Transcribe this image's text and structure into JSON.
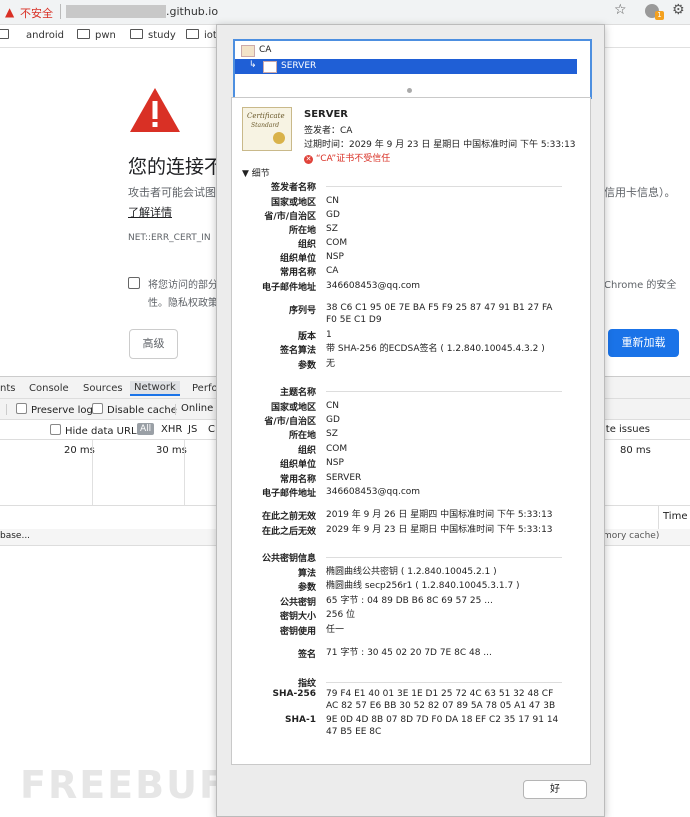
{
  "browser": {
    "insecure_label": "不安全",
    "url_suffix": ".github.io",
    "bookmarks": [
      "android",
      "pwn",
      "study",
      "iot"
    ],
    "extension_badge": "1"
  },
  "error_page": {
    "title": "您的连接不",
    "body": "攻击者可能会试图",
    "body_right": "信用卡信息）。",
    "learn_more": "了解详情",
    "error_code": "NET::ERR_CERT_IN",
    "checkbox_text_1": "将您访问的部分",
    "checkbox_text_1_right": "Chrome 的安全",
    "checkbox_text_2": "性。隐私权政策",
    "advanced_button": "高级",
    "reload_button": "重新加载"
  },
  "devtools": {
    "tabs": [
      "nts",
      "Console",
      "Sources",
      "Network",
      "Perfo"
    ],
    "active_tab": "Network",
    "preserve_log": "Preserve log",
    "disable_cache": "Disable cache",
    "online": "Online",
    "hide_data_urls": "Hide data URLs",
    "filter_all": "All",
    "filter_xhr": "XHR",
    "filter_js": "JS",
    "filter_c": "C",
    "site_issues": "ite issues",
    "timeline": [
      "20 ms",
      "30 ms",
      "80 ms"
    ],
    "time_header": "Time",
    "row_left": "base...",
    "row_right": "mory cache)"
  },
  "dialog": {
    "chain": [
      "CA",
      "SERVER"
    ],
    "ok_button": "好",
    "cert": {
      "name": "SERVER",
      "issuer_line": "签发者：CA",
      "expiry_line": "过期时间：2029 年 9 月 23 日 星期日 中国标准时间 下午 5:33:13",
      "untrusted": "“CA”证书不受信任",
      "details_label": "细节",
      "thumb_title": "Certificate",
      "thumb_subtitle": "Standard"
    },
    "issuer_section": {
      "title": "签发者名称",
      "rows": [
        {
          "label": "国家或地区",
          "value": "CN"
        },
        {
          "label": "省/市/自治区",
          "value": "GD"
        },
        {
          "label": "所在地",
          "value": "SZ"
        },
        {
          "label": "组织",
          "value": "COM"
        },
        {
          "label": "组织单位",
          "value": "NSP"
        },
        {
          "label": "常用名称",
          "value": "CA"
        },
        {
          "label": "电子邮件地址",
          "value": "346608453@qq.com"
        }
      ]
    },
    "serial": {
      "label": "序列号",
      "value": "38 C6 C1 95 0E 7E BA F5 F9 25 87 47 91 B1 27 FA F0 5E C1 D9"
    },
    "version": {
      "label": "版本",
      "value": "1"
    },
    "sig_alg": {
      "label": "签名算法",
      "value": "带 SHA-256 的ECDSA签名 ( 1.2.840.10045.4.3.2 )"
    },
    "params": {
      "label": "参数",
      "value": "无"
    },
    "subject_section": {
      "title": "主题名称",
      "rows": [
        {
          "label": "国家或地区",
          "value": "CN"
        },
        {
          "label": "省/市/自治区",
          "value": "GD"
        },
        {
          "label": "所在地",
          "value": "SZ"
        },
        {
          "label": "组织",
          "value": "COM"
        },
        {
          "label": "组织单位",
          "value": "NSP"
        },
        {
          "label": "常用名称",
          "value": "SERVER"
        },
        {
          "label": "电子邮件地址",
          "value": "346608453@qq.com"
        }
      ]
    },
    "validity": [
      {
        "label": "在此之前无效",
        "value": "2019 年 9 月 26 日 星期四 中国标准时间 下午 5:33:13"
      },
      {
        "label": "在此之后无效",
        "value": "2029 年 9 月 23 日 星期日 中国标准时间 下午 5:33:13"
      }
    ],
    "pubkey_section": {
      "title": "公共密钥信息",
      "rows": [
        {
          "label": "算法",
          "value": "椭圆曲线公共密钥 ( 1.2.840.10045.2.1 )"
        },
        {
          "label": "参数",
          "value": "椭圆曲线 secp256r1 ( 1.2.840.10045.3.1.7 )"
        },
        {
          "label": "公共密钥",
          "value": "65 字节 : 04 89 DB B6 8C 69 57 25 ..."
        },
        {
          "label": "密钥大小",
          "value": "256 位"
        },
        {
          "label": "密钥使用",
          "value": "任一"
        }
      ]
    },
    "signature": {
      "label": "签名",
      "value": "71 字节 : 30 45 02 20 7D 7E 8C 48 ..."
    },
    "fingerprint_section": {
      "title": "指纹",
      "rows": [
        {
          "label": "SHA-256",
          "value": "79 F4 E1 40 01 3E 1E D1 25 72 4C 63 51 32 48 CF AC 82 57 E6 BB 30 52 82 07 89 5A 78 05 A1 47 3B"
        },
        {
          "label": "SHA-1",
          "value": "9E 0D 4D 8B 07 8D 7D F0 DA 18 EF C2 35 17 91 14 47 B5 EE 8C"
        }
      ]
    }
  },
  "watermark": "FREEBUF",
  "colors": {
    "accent": "#1a73e8",
    "selection": "#1f5fd6",
    "danger": "#d93025"
  }
}
